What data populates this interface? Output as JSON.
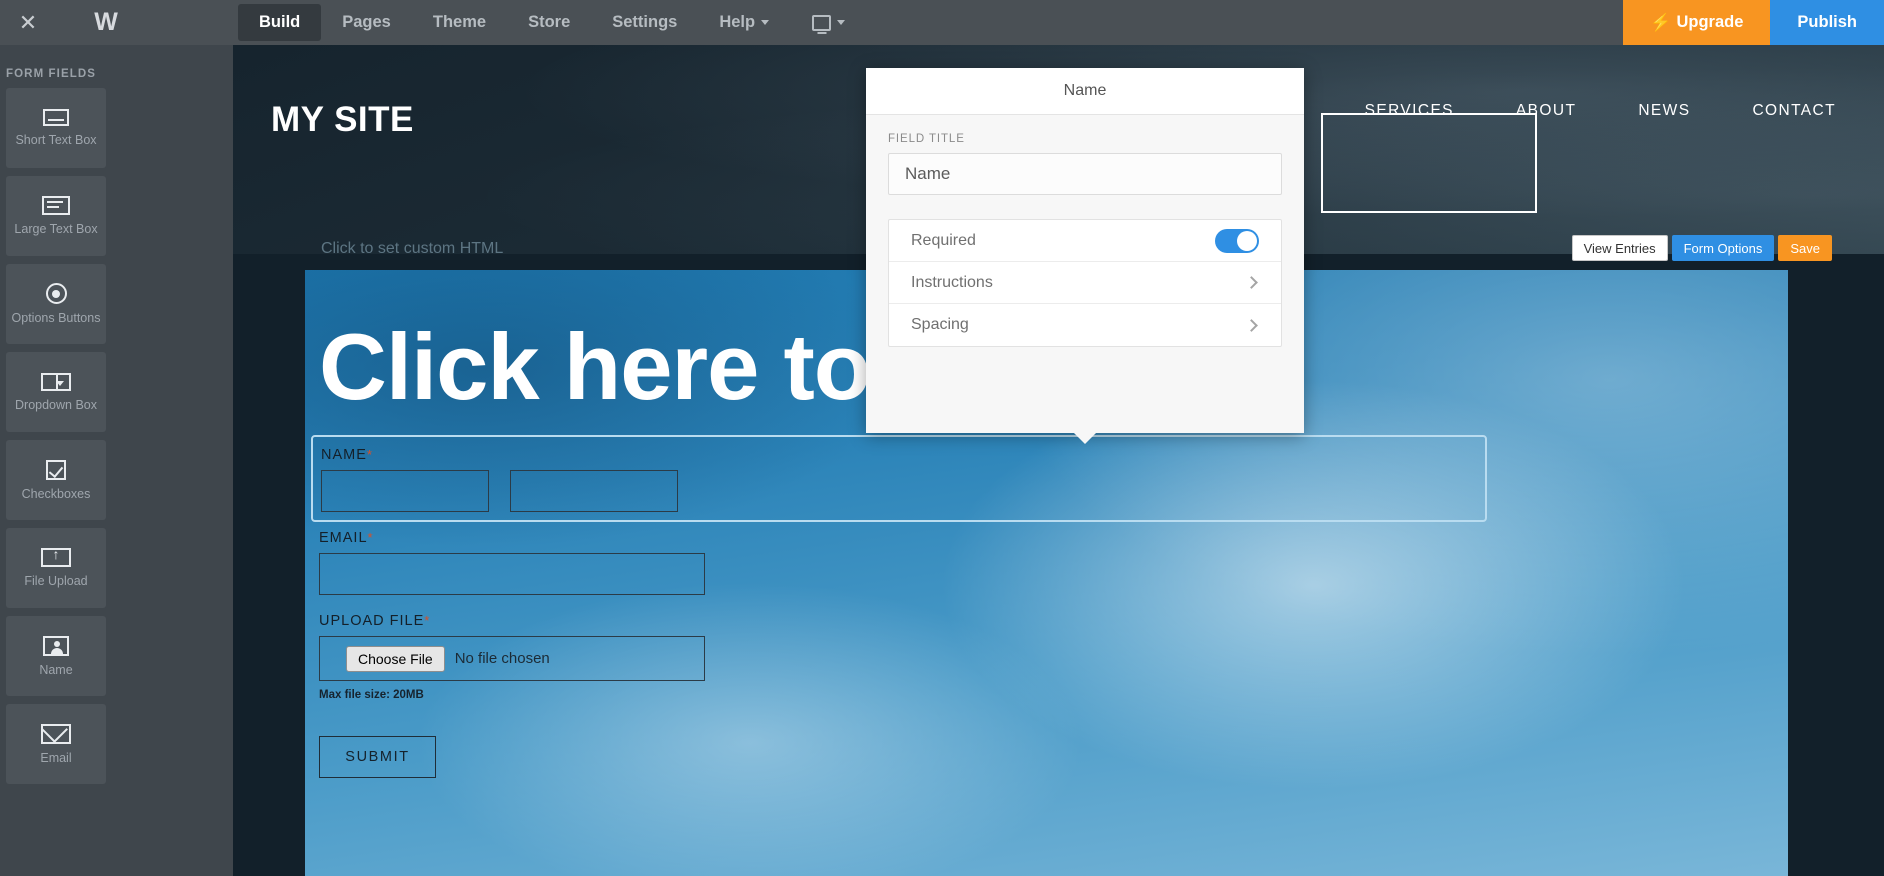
{
  "topbar": {
    "close_icon": "close-icon",
    "logo_glyph": "W",
    "nav": [
      {
        "label": "Build",
        "active": true,
        "caret": false
      },
      {
        "label": "Pages",
        "active": false,
        "caret": false
      },
      {
        "label": "Theme",
        "active": false,
        "caret": false
      },
      {
        "label": "Store",
        "active": false,
        "caret": false
      },
      {
        "label": "Settings",
        "active": false,
        "caret": false
      },
      {
        "label": "Help",
        "active": false,
        "caret": true
      }
    ],
    "device_icon": "monitor-icon",
    "upgrade_label": "Upgrade",
    "upgrade_icon": "bolt-icon",
    "publish_label": "Publish",
    "upgrade_color": "#f89521",
    "publish_color": "#2f8fe3"
  },
  "sidebar": {
    "title": "FORM FIELDS",
    "items": [
      {
        "label": "Short Text Box",
        "icon": "short-text-box-icon"
      },
      {
        "label": "Large Text Box",
        "icon": "large-text-box-icon"
      },
      {
        "label": "Options Buttons",
        "icon": "radio-button-icon"
      },
      {
        "label": "Dropdown Box",
        "icon": "dropdown-icon"
      },
      {
        "label": "Checkboxes",
        "icon": "checkbox-icon"
      },
      {
        "label": "File Upload",
        "icon": "file-upload-icon"
      },
      {
        "label": "Name",
        "icon": "person-icon"
      },
      {
        "label": "Email",
        "icon": "envelope-icon"
      }
    ]
  },
  "site": {
    "logo": "MY SITE",
    "nav": [
      "SERVICES",
      "ABOUT",
      "NEWS",
      "CONTACT"
    ],
    "edit_hint": "Click to set custom HTML",
    "hero_heading": "Click here to edit.",
    "form": {
      "name_label": "NAME",
      "email_label": "EMAIL",
      "upload_label": "UPLOAD FILE",
      "required_mark": "*",
      "choose_file_label": "Choose File",
      "no_file_text": "No file chosen",
      "max_file_size": "Max file size: 20MB",
      "submit_label": "SUBMIT"
    },
    "toolbar": {
      "view_entries": "View Entries",
      "form_options": "Form Options",
      "save": "Save"
    }
  },
  "popup": {
    "title": "Name",
    "field_title_label": "FIELD TITLE",
    "field_title_value": "Name",
    "options": [
      {
        "label": "Required",
        "control": "toggle",
        "state": "on"
      },
      {
        "label": "Instructions",
        "control": "chevron"
      },
      {
        "label": "Spacing",
        "control": "chevron"
      }
    ],
    "toggle_on_color": "#2f8fe3"
  }
}
